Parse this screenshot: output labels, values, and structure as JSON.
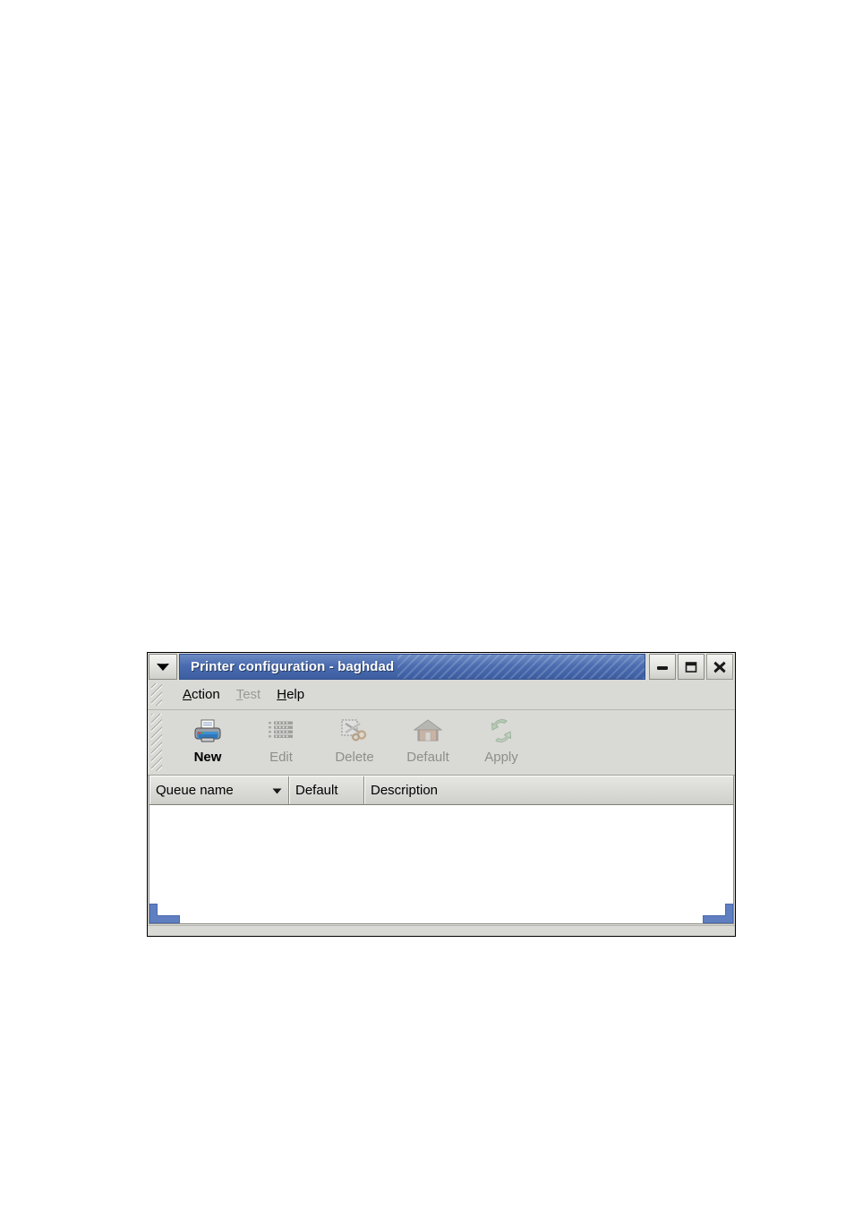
{
  "window": {
    "title": "Printer configuration - baghdad",
    "menu_button_icon": "chevron-down-icon",
    "controls": [
      {
        "name": "minimize-button",
        "icon": "minimize-icon",
        "label": "Minimize"
      },
      {
        "name": "maximize-button",
        "icon": "maximize-icon",
        "label": "Maximize"
      },
      {
        "name": "close-button",
        "icon": "close-icon",
        "label": "Close"
      }
    ],
    "colors": {
      "titlebar_active": "#4668ad",
      "titlebar_text": "#ffffff",
      "frame": "#d9d9d6",
      "grip_blue": "#4a6cb0",
      "list_background": "#ffffff"
    }
  },
  "menubar": {
    "handle_icon": "drag-handle-icon",
    "items": [
      {
        "label": "Action",
        "mnemonic": "A",
        "enabled": true
      },
      {
        "label": "Test",
        "mnemonic": "T",
        "enabled": false
      },
      {
        "label": "Help",
        "mnemonic": "H",
        "enabled": true
      }
    ]
  },
  "toolbar": {
    "handle_icon": "drag-handle-icon",
    "buttons": [
      {
        "label": "New",
        "icon": "printer-icon",
        "enabled": true
      },
      {
        "label": "Edit",
        "icon": "edit-list-icon",
        "enabled": false
      },
      {
        "label": "Delete",
        "icon": "scissors-cut-icon",
        "enabled": false
      },
      {
        "label": "Default",
        "icon": "home-icon",
        "enabled": false
      },
      {
        "label": "Apply",
        "icon": "refresh-arrows-icon",
        "enabled": false
      }
    ]
  },
  "printer_list": {
    "columns": [
      {
        "label": "Queue name",
        "sort_indicator": "▼",
        "sorted": true
      },
      {
        "label": "Default",
        "sort_indicator": "",
        "sorted": false
      },
      {
        "label": "Description",
        "sort_indicator": "",
        "sorted": false
      }
    ],
    "rows": []
  }
}
